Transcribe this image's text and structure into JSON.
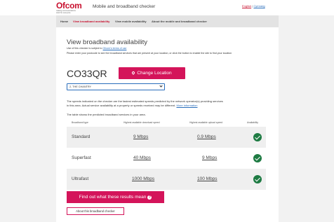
{
  "header": {
    "logo_text": "Ofcom",
    "logo_tagline": "making communications work for everyone",
    "app_title": "Mobile and broadband checker",
    "lang_english": "English",
    "lang_separator": "|",
    "lang_cymraeg": "Cymraeg"
  },
  "nav": {
    "items": [
      {
        "label": "Home"
      },
      {
        "label": "View broadband availability"
      },
      {
        "label": "View mobile availability"
      },
      {
        "label": "About the mobile and broadband checker"
      }
    ],
    "active_index": 1
  },
  "main": {
    "title": "View broadband availability",
    "intro_line1_prefix": "Use of this checker is subject to",
    "intro_line1_link": "Ofcom's terms of use",
    "intro_line2": "Please enter your postcode to see the broadband services that are present at your location, or click the button to enable the site to find your location",
    "postcode": "CO33QR",
    "change_location_label": "Change Location",
    "address_selected": "2, THE CHANTRY",
    "desc_line1": "The speeds indicated on the checker are the fastest estimated speeds predicted by the network operator(s) providing services",
    "desc_line2_prefix": "in this area. Actual service availability at a property or speeds received may be different.",
    "desc_line2_link": "More information",
    "desc_line3": "The table shows the predicted broadband services in your area."
  },
  "table": {
    "headers": [
      "Broadband type",
      "Highest available download speed",
      "Highest available upload speed",
      "Availability"
    ],
    "rows": [
      {
        "type": "Standard",
        "download": "9 Mbps",
        "upload": "0.9 Mbps",
        "available": true
      },
      {
        "type": "Superfast",
        "download": "40 Mbps",
        "upload": "9 Mbps",
        "available": true
      },
      {
        "type": "Ultrafast",
        "download": "1000 Mbps",
        "upload": "100 Mbps",
        "available": true
      }
    ]
  },
  "actions": {
    "results_button": "Find out what these results mean",
    "about_button": "About this broadband checker"
  },
  "colors": {
    "brand": "#c8102e",
    "button": "#d4145a",
    "available": "#1e7b43",
    "link": "#2a6ebb"
  }
}
